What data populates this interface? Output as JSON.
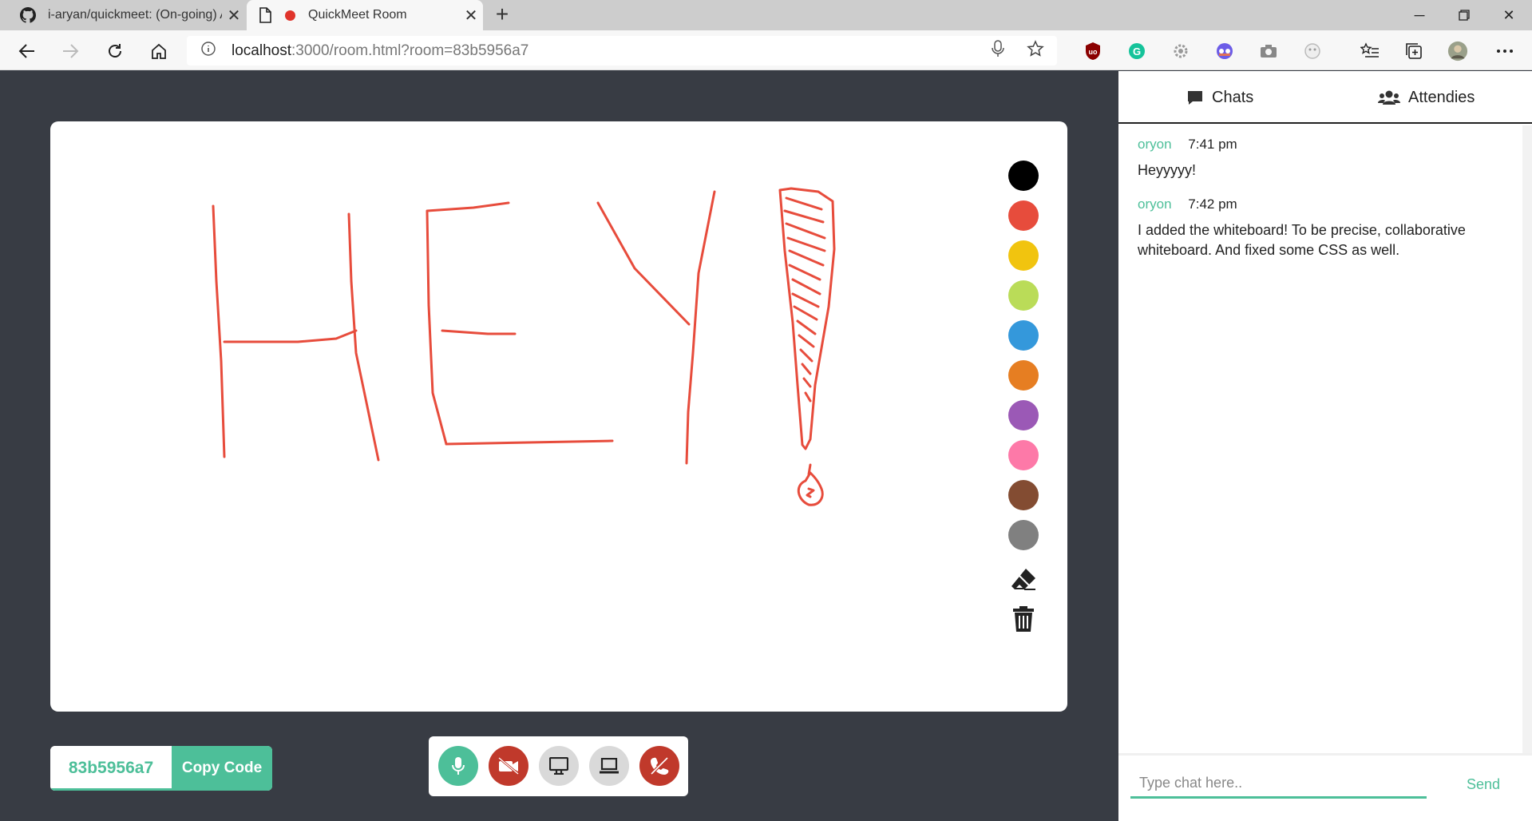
{
  "browser": {
    "tabs": [
      {
        "title": "i-aryan/quickmeet: (On-going) A",
        "active": false,
        "icon": "github-icon"
      },
      {
        "title": "QuickMeet Room",
        "active": true,
        "icon": "page-icon"
      }
    ],
    "url_host": "localhost",
    "url_rest": ":3000/room.html?room=83b5956a7"
  },
  "whiteboard": {
    "palette": [
      "#000000",
      "#e74c3c",
      "#f1c40f",
      "#badc58",
      "#3498db",
      "#e67e22",
      "#9b59b6",
      "#fd79a8",
      "#834c32",
      "#808080"
    ],
    "stroke_color": "#e74c3c"
  },
  "room": {
    "code": "83b5956a7",
    "copy_label": "Copy Code"
  },
  "panel": {
    "tabs": [
      {
        "label": "Chats",
        "icon": "comment-icon"
      },
      {
        "label": "Attendies",
        "icon": "users-icon"
      }
    ],
    "messages": [
      {
        "author": "oryon",
        "time": "7:41 pm",
        "text": "Heyyyyy!"
      },
      {
        "author": "oryon",
        "time": "7:42 pm",
        "text": "I added the whiteboard! To be precise, collaborative whiteboard. And fixed some CSS as well."
      }
    ],
    "input_placeholder": "Type chat here..",
    "send_label": "Send"
  },
  "colors": {
    "accent": "#4dbf99",
    "background": "#383c44",
    "danger": "#c0392b"
  }
}
